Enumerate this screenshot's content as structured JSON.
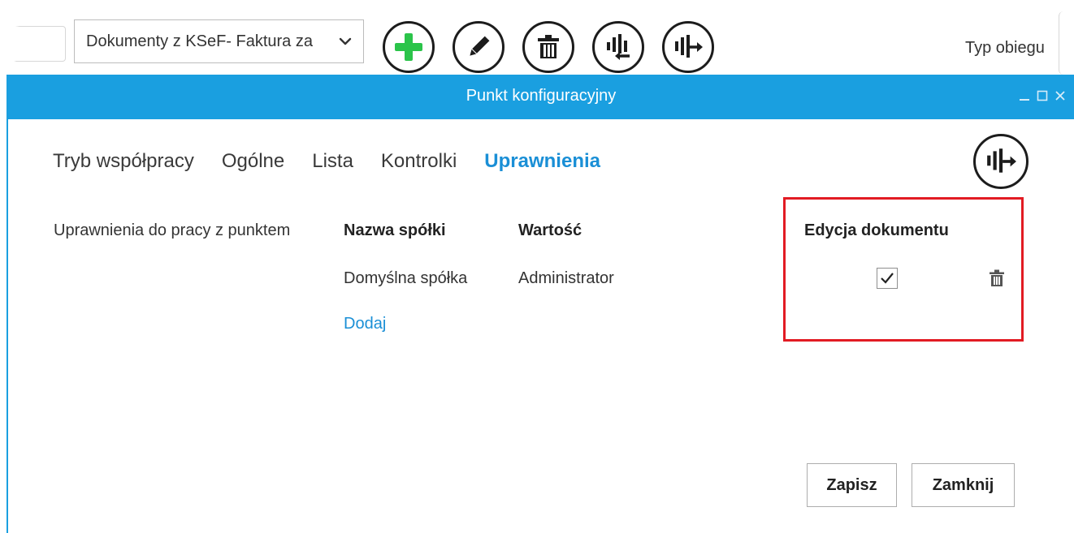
{
  "toolbar": {
    "selected_document": "Dokumenty z KSeF- Faktura za",
    "type_label": "Typ obiegu",
    "icons": [
      "plus-icon",
      "pencil-icon",
      "trash-icon",
      "import-icon",
      "export-icon"
    ],
    "colors": {
      "add": "#2bc44a",
      "stroke": "#1c1c1c"
    }
  },
  "dialog": {
    "title": "Punkt konfiguracyjny",
    "titlebar_color": "#1a9fe0",
    "tabs": [
      {
        "label": "Tryb współpracy",
        "active": false
      },
      {
        "label": "Ogólne",
        "active": false
      },
      {
        "label": "Lista",
        "active": false
      },
      {
        "label": "Kontrolki",
        "active": false
      },
      {
        "label": "Uprawnienia",
        "active": true
      }
    ],
    "accent_color": "#1a8fd6",
    "section_label": "Uprawnienia do pracy z punktem",
    "columns": {
      "company": "Nazwa spółki",
      "value": "Wartość"
    },
    "rows": [
      {
        "company": "Domyślna spółka",
        "value": "Administrator",
        "edit_document": true
      }
    ],
    "add_link": "Dodaj",
    "permission_header": "Edycja dokumentu",
    "highlight_color": "#e21b23",
    "buttons": {
      "save": "Zapisz",
      "close": "Zamknij"
    }
  }
}
